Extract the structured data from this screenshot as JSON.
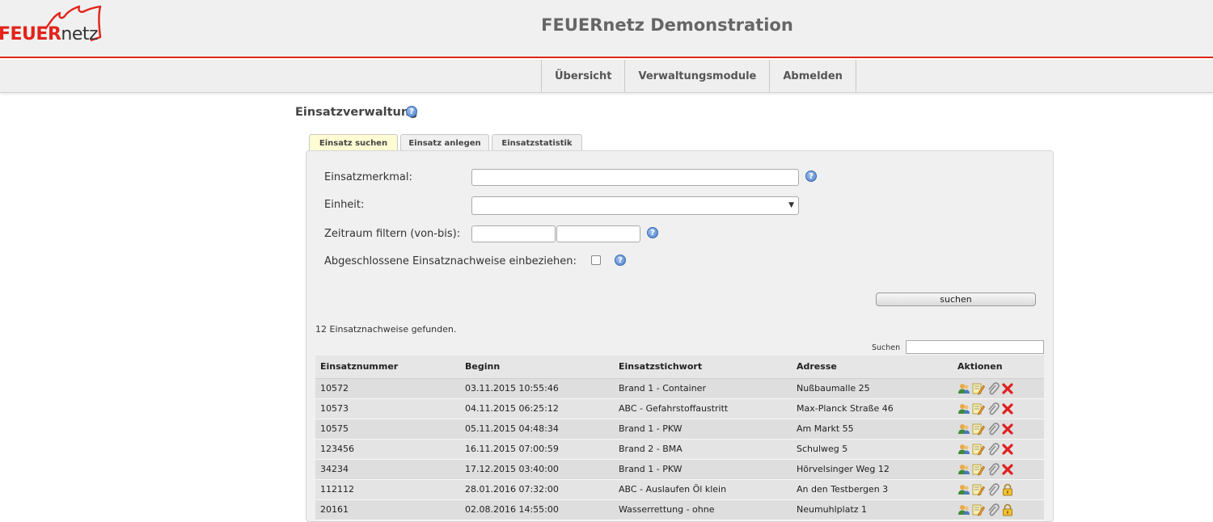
{
  "header": {
    "logo_red": "FEUER",
    "logo_dark": "netz",
    "site_title": "FEUERnetz Demonstration"
  },
  "nav": {
    "items": [
      "Übersicht",
      "Verwaltungsmodule",
      "Abmelden"
    ]
  },
  "page": {
    "title": "Einsatzverwaltung"
  },
  "tabs": [
    {
      "label": "Einsatz suchen",
      "active": true
    },
    {
      "label": "Einsatz anlegen",
      "active": false
    },
    {
      "label": "Einsatzstatistik",
      "active": false
    }
  ],
  "form": {
    "merkmal_label": "Einsatzmerkmal:",
    "merkmal_value": "",
    "einheit_label": "Einheit:",
    "einheit_value": "",
    "zeitraum_label": "Zeitraum filtern (von-bis):",
    "zeitraum_von": "",
    "zeitraum_bis": "",
    "abgeschlossen_label": "Abgeschlossene Einsatznachweise einbeziehen:",
    "abgeschlossen_checked": false,
    "search_button": "suchen"
  },
  "results": {
    "count_text": "12 Einsatznachweise gefunden.",
    "search_label": "Suchen",
    "search_value": "",
    "columns": [
      "Einsatznummer",
      "Beginn",
      "Einsatzstichwort",
      "Adresse",
      "Aktionen"
    ],
    "rows": [
      {
        "nummer": "10572",
        "beginn": "03.11.2015 10:55:46",
        "stichwort": "Brand 1 - Container",
        "adresse": "Nußbaumalle 25",
        "locked": false
      },
      {
        "nummer": "10573",
        "beginn": "04.11.2015 06:25:12",
        "stichwort": "ABC - Gefahrstoffaustritt",
        "adresse": "Max-Planck Straße 46",
        "locked": false
      },
      {
        "nummer": "10575",
        "beginn": "05.11.2015 04:48:34",
        "stichwort": "Brand 1 - PKW",
        "adresse": "Am Markt 55",
        "locked": false
      },
      {
        "nummer": "123456",
        "beginn": "16.11.2015 07:00:59",
        "stichwort": "Brand 2 - BMA",
        "adresse": "Schulweg 5",
        "locked": false
      },
      {
        "nummer": "34234",
        "beginn": "17.12.2015 03:40:00",
        "stichwort": "Brand 1 - PKW",
        "adresse": "Hörvelsinger Weg 12",
        "locked": false
      },
      {
        "nummer": "112112",
        "beginn": "28.01.2016 07:32:00",
        "stichwort": "ABC - Auslaufen Öl klein",
        "adresse": "An den Testbergen 3",
        "locked": true
      },
      {
        "nummer": "20161",
        "beginn": "02.08.2016 14:55:00",
        "stichwort": "Wasserrettung - ohne",
        "adresse": "Neumuhlplatz 1",
        "locked": true
      }
    ]
  },
  "colors": {
    "accent_red": "#e2231a",
    "active_tab": "#fffcd3"
  }
}
